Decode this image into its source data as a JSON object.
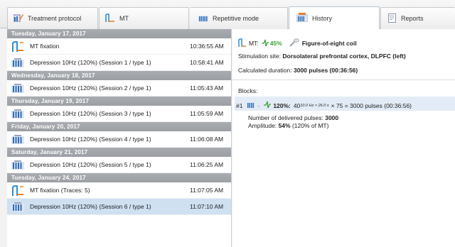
{
  "tabs": [
    {
      "label": "Treatment protocol",
      "icon": "protocol-icon"
    },
    {
      "label": "MT",
      "icon": "mt-icon"
    },
    {
      "label": "Repetitive mode",
      "icon": "repetitive-icon"
    },
    {
      "label": "History",
      "icon": "history-icon",
      "active": true
    },
    {
      "label": "Reports",
      "icon": "reports-icon"
    }
  ],
  "history": {
    "days": [
      {
        "date": "Tuesday, January 17, 2017",
        "items": [
          {
            "type": "mt",
            "label": "MT fixation",
            "time": "10:36:55 AM"
          },
          {
            "type": "rep",
            "label": "Depression 10Hz (120%) (Session 1 / type 1)",
            "time": "10:58:41 AM"
          }
        ]
      },
      {
        "date": "Wednesday, January 18, 2017",
        "items": [
          {
            "type": "rep",
            "label": "Depression 10Hz (120%) (Session 2 / type 1)",
            "time": "11:05:43 AM"
          }
        ]
      },
      {
        "date": "Thursday, January 19, 2017",
        "items": [
          {
            "type": "rep",
            "label": "Depression 10Hz (120%) (Session 3 / type 1)",
            "time": "11:05:59 AM"
          }
        ]
      },
      {
        "date": "Friday, January 20, 2017",
        "items": [
          {
            "type": "rep",
            "label": "Depression 10Hz (120%) (Session 4 / type 1)",
            "time": "11:06:08 AM"
          }
        ]
      },
      {
        "date": "Saturday, January 21, 2017",
        "items": [
          {
            "type": "rep",
            "label": "Depression 10Hz (120%) (Session 5 / type 1)",
            "time": "11:06:25 AM"
          }
        ]
      },
      {
        "date": "Tuesday, January 24, 2017",
        "items": [
          {
            "type": "mt",
            "label": "MT fixation (Traces: 5)",
            "time": "11:07:05 AM"
          },
          {
            "type": "rep",
            "label": "Depression 10Hz (120%) (Session 6 / type 1)",
            "time": "11:07:10 AM",
            "selected": true
          }
        ]
      }
    ]
  },
  "detail": {
    "mt_label": "MT:",
    "mt_value": "45%",
    "coil": "Figure-of-eight coil",
    "site_label": "Stimulation site:",
    "site_value": "Dorsolateral prefrontal cortex, DLPFC (left)",
    "duration_label": "Calculated duration:",
    "duration_value": "3000 pulses (00:36:56)",
    "blocks_label": "Blocks:",
    "block": {
      "index": "#1",
      "intensity": "120%:",
      "base": "40",
      "sup": "10.0 Hz × 26.0 s",
      "formula_rest": "× 75 = 3000 pulses (00:36:56)",
      "pulses_label": "Number of delivered pulses:",
      "pulses_value": "3000",
      "amplitude_label": "Amplitude:",
      "amplitude_value": "54%",
      "amplitude_note": "(120% of MT)"
    }
  },
  "colors": {
    "day_header": "#9fa2a7",
    "selection": "#cfe0f1",
    "mt_icon_orange": "#e8801e",
    "rep_icon_blue": "#2e6db8",
    "pulse_green": "#3aa335"
  }
}
